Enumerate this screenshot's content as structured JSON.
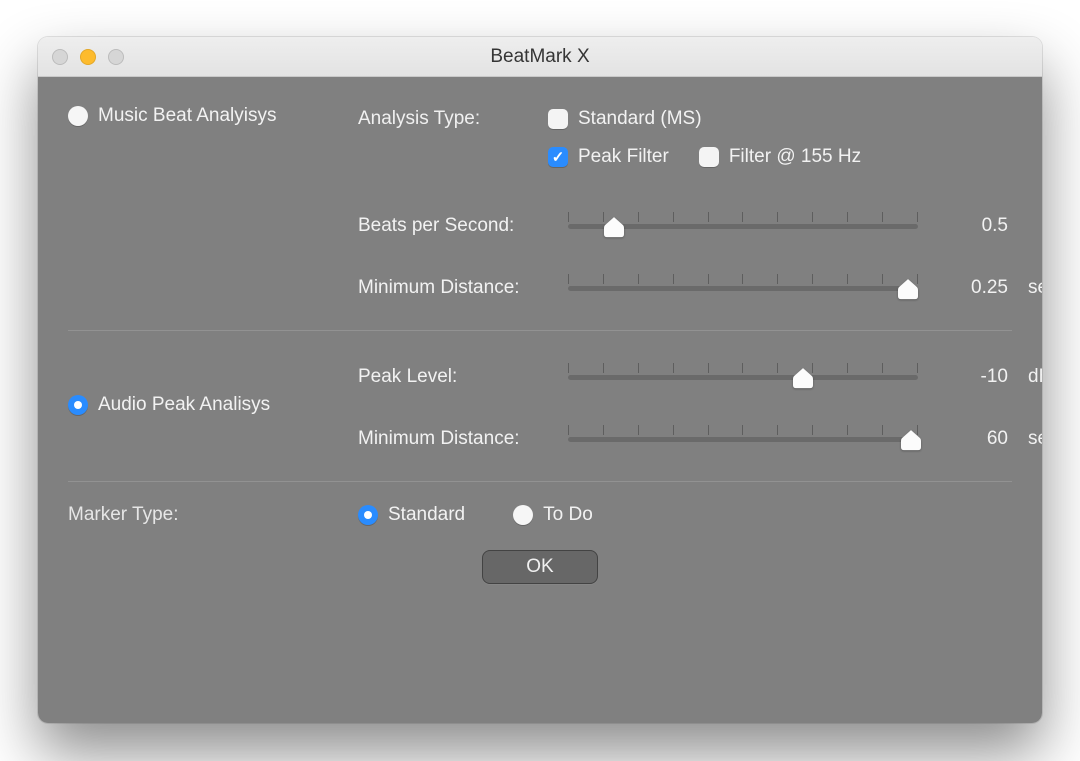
{
  "window": {
    "title": "BeatMark X"
  },
  "sectionA": {
    "radio_label": "Music Beat Analyisys",
    "radio_selected": false,
    "analysis_type_label": "Analysis Type:",
    "checks": {
      "standard": {
        "label": "Standard (MS)",
        "checked": false
      },
      "peak_filter": {
        "label": "Peak Filter",
        "checked": true
      },
      "filter_155": {
        "label": "Filter @ 155 Hz",
        "checked": false
      }
    },
    "bps": {
      "label": "Beats per Second:",
      "value": "0.5",
      "unit": "",
      "pos": 0.13
    },
    "mind": {
      "label": "Minimum Distance:",
      "value": "0.25",
      "unit": "secs",
      "pos": 0.97
    }
  },
  "sectionB": {
    "radio_label": "Audio Peak Analisys",
    "radio_selected": true,
    "peak": {
      "label": "Peak Level:",
      "value": "-10",
      "unit": "dB",
      "pos": 0.67
    },
    "mind": {
      "label": "Minimum Distance:",
      "value": "60",
      "unit": "secs",
      "pos": 0.98
    }
  },
  "markerType": {
    "label": "Marker Type:",
    "options": {
      "standard": {
        "label": "Standard",
        "selected": true
      },
      "todo": {
        "label": "To Do",
        "selected": false
      }
    }
  },
  "ok_label": "OK",
  "slider_ticks": 11
}
